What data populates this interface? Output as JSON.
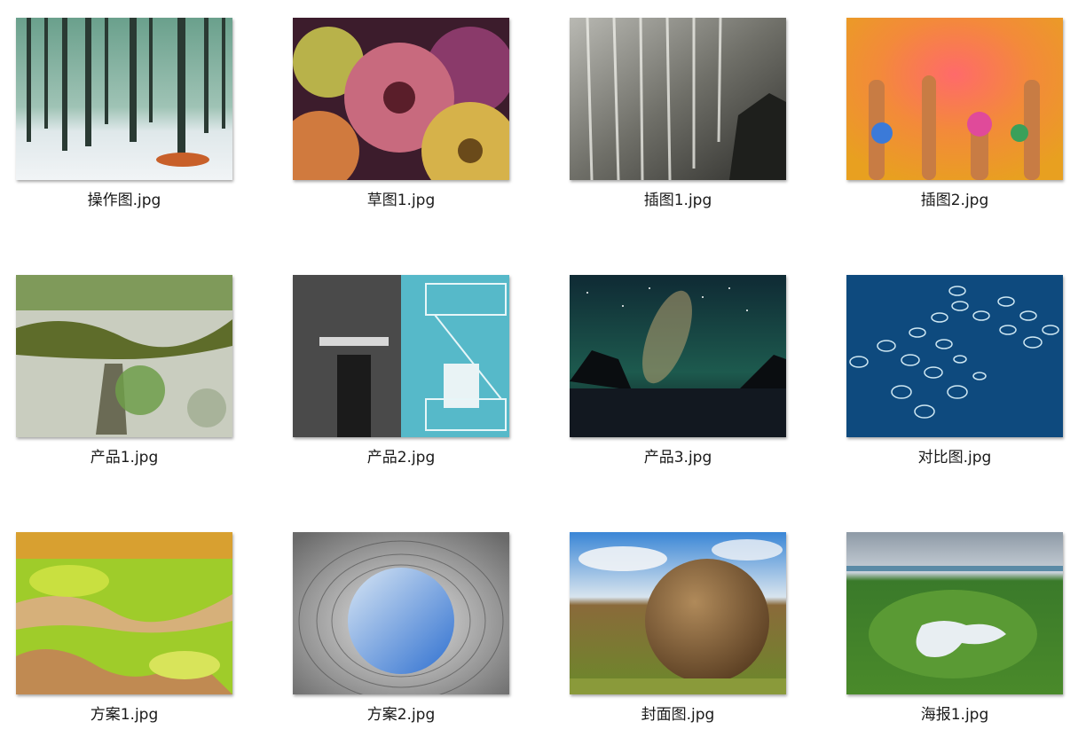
{
  "files": [
    {
      "name": "操作图.jpg",
      "thumbnail": "misty-birch-forest"
    },
    {
      "name": "草图1.jpg",
      "thumbnail": "yarn-balls"
    },
    {
      "name": "插图1.jpg",
      "thumbnail": "waterfall"
    },
    {
      "name": "插图2.jpg",
      "thumbnail": "colored-powder-hands"
    },
    {
      "name": "产品1.jpg",
      "thumbnail": "mossy-tree-branch"
    },
    {
      "name": "产品2.jpg",
      "thumbnail": "city-building-facade"
    },
    {
      "name": "产品3.jpg",
      "thumbnail": "milky-way-coast"
    },
    {
      "name": "对比图.jpg",
      "thumbnail": "ocean-fish-pens"
    },
    {
      "name": "方案1.jpg",
      "thumbnail": "colorful-geothermal-terrain"
    },
    {
      "name": "方案2.jpg",
      "thumbnail": "architecture-oculus"
    },
    {
      "name": "封面图.jpg",
      "thumbnail": "stone-sphere-hill"
    },
    {
      "name": "海报1.jpg",
      "thumbnail": "green-crater-lake"
    }
  ]
}
